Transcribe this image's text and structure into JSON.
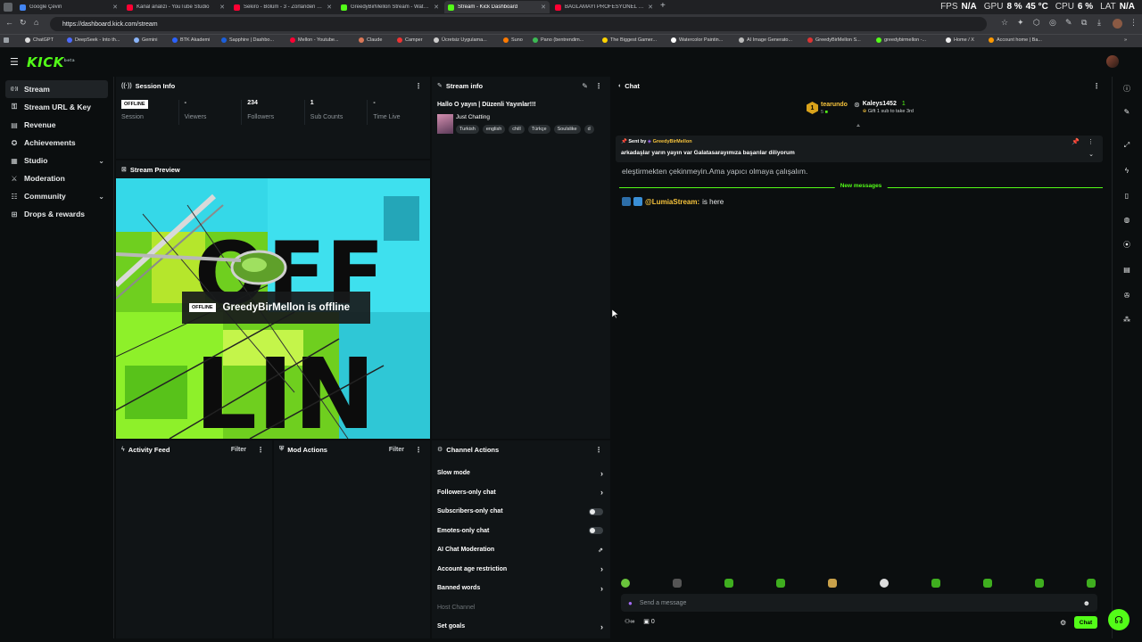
{
  "browser": {
    "tabs": [
      {
        "label": "Google Çeviri",
        "color": "#4285f4"
      },
      {
        "label": "Kanal analizi - YouTube Studio",
        "color": "#ff0033"
      },
      {
        "label": "Sekiro - Bölüm - 3 - Zorlanden m...",
        "color": "#ff0033"
      },
      {
        "label": "GreedyBirMellon Stream - Watch ...",
        "color": "#53fc18"
      },
      {
        "label": "Stream - Kick Dashboard",
        "color": "#53fc18"
      },
      {
        "label": "BAĞLAMAYI PROFESYONEL ÇALM...",
        "color": "#ff0033"
      }
    ],
    "url": "https://dashboard.kick.com/stream",
    "perf": {
      "fps_label": "FPS",
      "fps": "N/A",
      "gpu_label": "GPU",
      "gpu": "8 %",
      "gpu_temp": "45 °C",
      "cpu_label": "CPU",
      "cpu": "6 %",
      "lat_label": "LAT",
      "lat": "N/A"
    },
    "bookmarks": [
      "ChatGPT",
      "DeepSeek - Into th...",
      "Gemini",
      "BTK Akademi",
      "Sapphire | Dashbo...",
      "Mellon - Youtube...",
      "Claude",
      "Camper",
      "Ücretsiz Uygulama...",
      "Suno",
      "Pano (bentrendim...",
      "The Biggest Gamer...",
      "Watercolor Paintin...",
      "AI Image Generato...",
      "GreedyBirMellon S...",
      "greedybirmellon -...",
      "Home / X",
      "Account home | Ba..."
    ]
  },
  "logo": "KICK",
  "logo_badge": "beta",
  "sidebar": {
    "items": [
      {
        "label": "Stream",
        "icon": "broadcast-icon",
        "glyph": "((·))"
      },
      {
        "label": "Stream URL & Key",
        "icon": "key-icon",
        "glyph": "⚿"
      },
      {
        "label": "Revenue",
        "icon": "money-icon",
        "glyph": "▤"
      },
      {
        "label": "Achievements",
        "icon": "trophy-icon",
        "glyph": "✪"
      },
      {
        "label": "Studio",
        "icon": "layout-icon",
        "glyph": "▦"
      },
      {
        "label": "Moderation",
        "icon": "sword-icon",
        "glyph": "⚔"
      },
      {
        "label": "Community",
        "icon": "people-icon",
        "glyph": "☷"
      },
      {
        "label": "Drops & rewards",
        "icon": "gift-icon",
        "glyph": "⊞"
      }
    ]
  },
  "session": {
    "title": "Session Info",
    "offline": "OFFLINE",
    "stats": [
      {
        "value": "",
        "label": "Session"
      },
      {
        "value": "-",
        "label": "Viewers"
      },
      {
        "value": "234",
        "label": "Followers"
      },
      {
        "value": "1",
        "label": "Sub Counts"
      },
      {
        "value": "-",
        "label": "Time Live"
      }
    ]
  },
  "stream_info": {
    "title": "Stream info",
    "stream_title": "Hallo O yayın | Düzenli Yayınlar!!!",
    "category": "Just Chatting",
    "tags": [
      "Turkish",
      "english",
      "chill",
      "Türkçe",
      "Soulslike",
      "d"
    ]
  },
  "preview": {
    "title": "Stream Preview",
    "badge": "OFFLINE",
    "text": "GreedyBirMellon is offline"
  },
  "activity": {
    "title": "Activity Feed",
    "filter": "Filter"
  },
  "mod_actions": {
    "title": "Mod Actions",
    "filter": "Filter"
  },
  "channel_actions": {
    "title": "Channel Actions",
    "rows": [
      {
        "label": "Slow mode",
        "kind": "arrow"
      },
      {
        "label": "Followers-only chat",
        "kind": "arrow"
      },
      {
        "label": "Subscribers-only chat",
        "kind": "toggle"
      },
      {
        "label": "Emotes-only chat",
        "kind": "toggle"
      },
      {
        "label": "AI Chat Moderation",
        "kind": "external"
      },
      {
        "label": "Account age restriction",
        "kind": "arrow"
      },
      {
        "label": "Banned words",
        "kind": "arrow"
      },
      {
        "label": "Host Channel",
        "kind": "disabled"
      },
      {
        "label": "Set goals",
        "kind": "arrow"
      }
    ]
  },
  "chat": {
    "title": "Chat",
    "gifters": [
      {
        "rank": "1",
        "name": "tearundo",
        "sub": "5"
      },
      {
        "rank": "",
        "name": "Kaleys1452",
        "sub": "Gift 1 sub to take 3rd",
        "count": "1"
      }
    ],
    "pinned": {
      "sent_by_label": "Sent by",
      "sender": "GreedyBirMellon",
      "text": "arkadaşlar yarın yayın var Galatasarayımıza başarılar diliyorum"
    },
    "cut_message": "eleştirmekten çekinmeyin.Ama yapıcı olmaya çalışalım.",
    "new_messages": "New messages",
    "message": {
      "user": "@LumiaStream:",
      "text": "is here"
    },
    "input_placeholder": "Send a message",
    "viewers": "0",
    "send_label": "Chat"
  },
  "colors": {
    "accent": "#53fc18",
    "bg": "#0b0e0f",
    "panel": "#101416"
  }
}
